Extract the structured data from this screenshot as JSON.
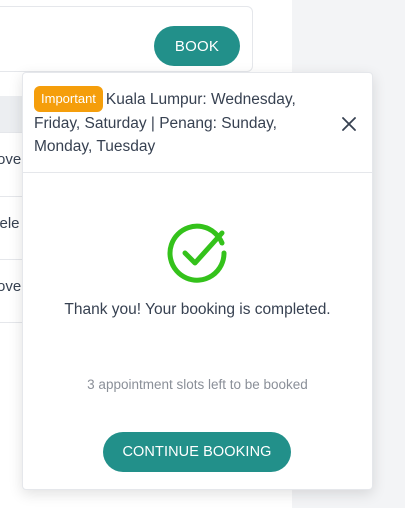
{
  "background": {
    "book_button_label": "BOOK",
    "list_rows": [
      "rove",
      "cele",
      "rove"
    ]
  },
  "modal": {
    "badge": "Important",
    "message": "Kuala Lumpur: Wednesday, Friday, Saturday | Penang: Sunday, Monday, Tuesday",
    "success_icon": "check-circle-icon",
    "close_icon": "close-icon",
    "thanks_text": "Thank you! Your booking is completed.",
    "slots_text": "3 appointment slots left to be booked",
    "continue_label": "CONTINUE BOOKING"
  },
  "colors": {
    "accent": "#22908a",
    "badge": "#f59e0b",
    "success": "#34c21b"
  }
}
